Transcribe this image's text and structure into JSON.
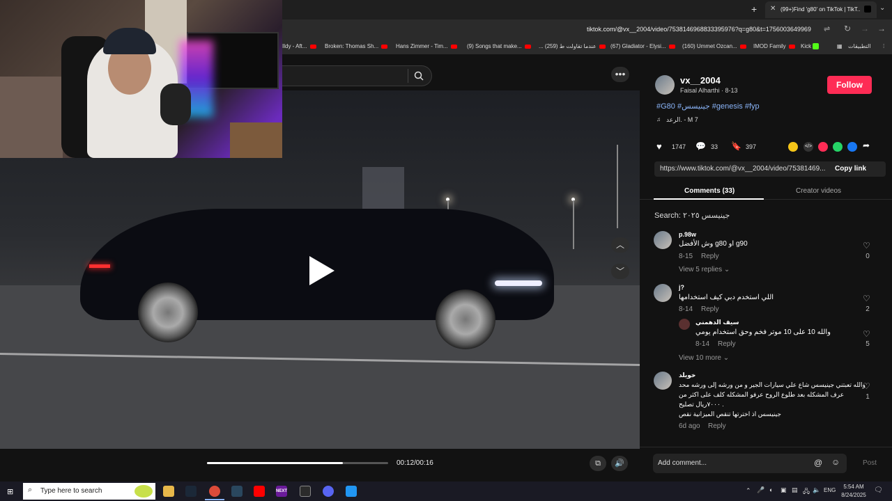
{
  "browser": {
    "tab_title": "(99+)Find 'g80' on TikTok | TikT...",
    "new_tab_symbol": "+",
    "url": "tiktok.com/@vx__2004/video/7538146968833395976?q=g80&t=1756003649969",
    "bookmarks": [
      "Ildy - Aft...",
      "Broken: Thomas Sh...",
      "Hans Zimmer - Tim...",
      "(9) Songs that make...",
      "... عندما تقاولت ط (259)",
      "(67) Gladiator - Elysi...",
      "(160) Ummet Ozcan...",
      "IMOD Family",
      "Kick",
      "التطبيقات"
    ]
  },
  "video": {
    "time": "00:12/00:16",
    "progress_fraction": 0.75
  },
  "post": {
    "username": "vx__2004",
    "display_line": "Faisal Alharthi · 8-13",
    "follow_label": "Follow",
    "hashtags": "#G80 #جينيسس #genesis #fyp",
    "music": "الرعد. - M 7",
    "likes": "1747",
    "comments": "33",
    "saves": "397",
    "link": "https://www.tiktok.com/@vx__2004/video/75381469...",
    "copy_link": "Copy link",
    "tab_comments": "Comments (33)",
    "tab_creator": "Creator videos",
    "search_hint": "Search: جينيسس ٢٠٢٥"
  },
  "comments": [
    {
      "user": "p.98w",
      "text": "وش الأفضل g80 او g90",
      "date": "8-15",
      "reply": "Reply",
      "likes": "0",
      "view_replies": "View 5 replies"
    },
    {
      "user": "j?",
      "text": "اللي استخدم دبي كيف استخدامها",
      "date": "8-14",
      "reply": "Reply",
      "likes": "2"
    },
    {
      "user": "سيف الدهمني",
      "text": "والله 10 على 10 موتر فخم وحق استخدام يومي",
      "date": "8-14",
      "reply": "Reply",
      "likes": "5",
      "view_more": "View 10 more"
    },
    {
      "user": "خويلد",
      "text1": "والله تعبتني جينيسس شاع علي سيارات الجير و من ورشه إلى ورشه محد",
      "text2": "عرف المشكله بعد طلوع الروح عرفو المشكله كلف على اكثر من",
      "text3": "٧٠٠٠ريال تصليح .",
      "text4": "جينيسس اذ اخترتها تنقص الميزانية نقص",
      "date": "6d ago",
      "reply": "Reply",
      "likes": "1"
    }
  ],
  "comment_input": {
    "placeholder": "Add comment...",
    "post": "Post"
  },
  "taskbar": {
    "search_placeholder": "Type here to search",
    "lang": "ENG",
    "time": "5:54 AM",
    "date": "8/24/2025",
    "next_label": "NEXT"
  },
  "colors": {
    "accent": "#fe2c55",
    "background": "#121212"
  }
}
